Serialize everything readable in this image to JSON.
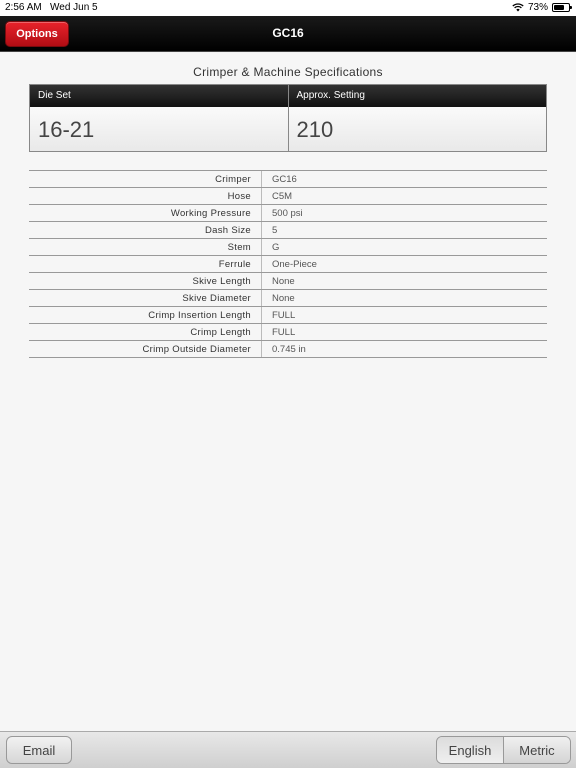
{
  "status_bar": {
    "time": "2:56 AM",
    "date": "Wed Jun 5",
    "battery": "73%",
    "battery_level": 0.73,
    "wifi_icon": "wifi-icon",
    "battery_icon": "battery-icon"
  },
  "nav": {
    "options_label": "Options",
    "title": "GC16",
    "accent_color": "#d4141c"
  },
  "section": {
    "title": "Crimper & Machine Specifications"
  },
  "spec": {
    "die_set_label": "Die Set",
    "die_set_value": "16-21",
    "setting_label": "Approx. Setting",
    "setting_value": "210"
  },
  "details": [
    {
      "label": "Crimper",
      "value": "GC16"
    },
    {
      "label": "Hose",
      "value": "C5M"
    },
    {
      "label": "Working Pressure",
      "value": "500 psi"
    },
    {
      "label": "Dash Size",
      "value": "5"
    },
    {
      "label": "Stem",
      "value": "G"
    },
    {
      "label": "Ferrule",
      "value": "One-Piece"
    },
    {
      "label": "Skive Length",
      "value": "None"
    },
    {
      "label": "Skive Diameter",
      "value": "None"
    },
    {
      "label": "Crimp Insertion Length",
      "value": "FULL"
    },
    {
      "label": "Crimp Length",
      "value": "FULL"
    },
    {
      "label": "Crimp Outside Diameter",
      "value": "0.745 in"
    }
  ],
  "toolbar": {
    "email_label": "Email",
    "english_label": "English",
    "metric_label": "Metric",
    "selected_unit": "English"
  }
}
